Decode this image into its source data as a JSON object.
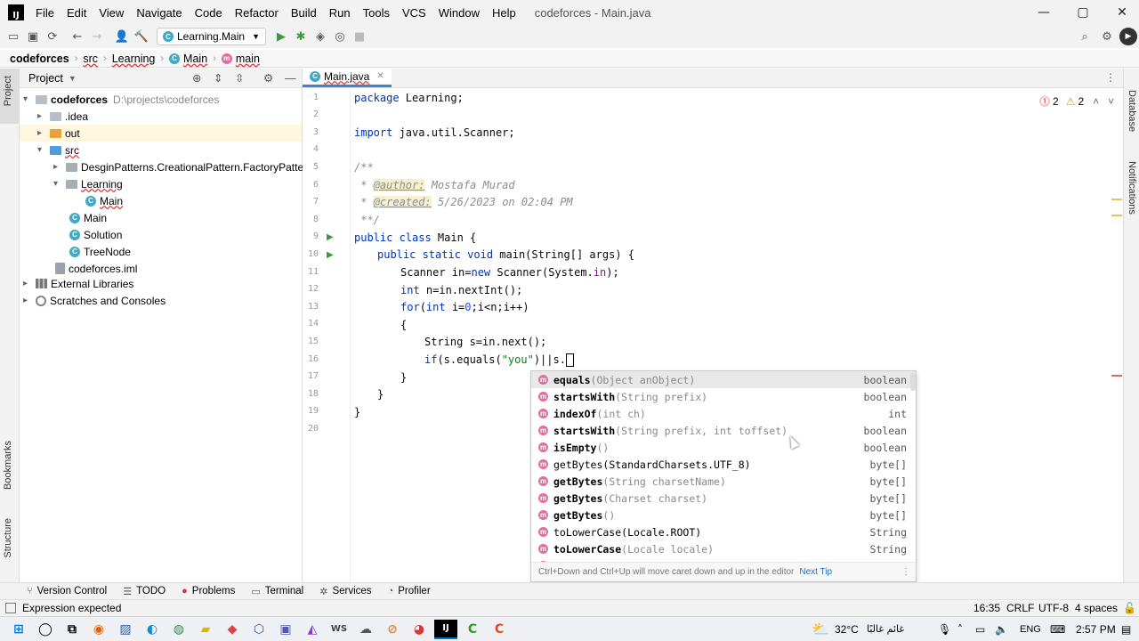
{
  "menubar": {
    "logo": "IJ",
    "items": [
      "File",
      "Edit",
      "View",
      "Navigate",
      "Code",
      "Refactor",
      "Build",
      "Run",
      "Tools",
      "VCS",
      "Window",
      "Help"
    ],
    "title": "codeforces - Main.java"
  },
  "toolbar": {
    "run_config": "Learning.Main"
  },
  "breadcrumbs": [
    "codeforces",
    "src",
    "Learning",
    "Main",
    "main"
  ],
  "project_panel": {
    "title": "Project",
    "tree": [
      {
        "label": "codeforces",
        "extra": "D:\\projects\\codeforces"
      },
      {
        "label": ".idea"
      },
      {
        "label": "out"
      },
      {
        "label": "src"
      },
      {
        "label": "DesginPatterns.CreationalPattern.FactoryPattern"
      },
      {
        "label": "Learning"
      },
      {
        "label": "Main"
      },
      {
        "label": "Main"
      },
      {
        "label": "Solution"
      },
      {
        "label": "TreeNode"
      },
      {
        "label": "codeforces.iml"
      },
      {
        "label": "External Libraries"
      },
      {
        "label": "Scratches and Consoles"
      }
    ]
  },
  "side_labels": {
    "project": "Project",
    "bookmarks": "Bookmarks",
    "structure": "Structure",
    "database": "Database",
    "notifications": "Notifications"
  },
  "editor": {
    "tab": "Main.java",
    "errors": "2",
    "warnings": "2",
    "line_numbers": [
      "1",
      "2",
      "3",
      "4",
      "5",
      "6",
      "7",
      "8",
      "9",
      "10",
      "11",
      "12",
      "13",
      "14",
      "15",
      "16",
      "17",
      "18",
      "19",
      "20"
    ],
    "code": {
      "l1_kw": "package",
      "l1_rest": " Learning;",
      "l3_kw": "import",
      "l3_rest": " java.util.Scanner;",
      "l5": "/**",
      "l6_pre": " * ",
      "l6_tag": "@author:",
      "l6_rest": " Mostafa Murad",
      "l7_pre": " * ",
      "l7_tag": "@created:",
      "l7_rest": " 5/26/2023 on 02:04 PM",
      "l8": " **/",
      "l9_kw": "public class",
      "l9_rest": " Main {",
      "l10_kw": "public static void",
      "l10_rest": " main(String[] args) {",
      "l11_a": "Scanner in=",
      "l11_kw": "new",
      "l11_b": " Scanner(System.",
      "l11_f": "in",
      "l11_c": ");",
      "l12_kw": "int",
      "l12_rest": " n=in.nextInt();",
      "l13_kw": "for",
      "l13_a": "(",
      "l13_kw2": "int",
      "l13_b": " i=",
      "l13_n": "0",
      "l13_c": ";i<n;i++)",
      "l14": "{",
      "l15": "String s=in.next();",
      "l16_kw": "if",
      "l16_a": "(s.equals(",
      "l16_s": "\"you\"",
      "l16_b": ")||s.",
      "l17": "}",
      "l18": "}",
      "l19": "}"
    }
  },
  "completion": {
    "items": [
      {
        "name": "equals",
        "params": "(Object anObject)",
        "type": "boolean"
      },
      {
        "name": "startsWith",
        "params": "(String prefix)",
        "type": "boolean"
      },
      {
        "name": "indexOf",
        "params": "(int ch)",
        "type": "int"
      },
      {
        "name": "startsWith",
        "params": "(String prefix, int toffset)",
        "type": "boolean"
      },
      {
        "name": "isEmpty",
        "params": "()",
        "type": "boolean"
      },
      {
        "name": "getBytes",
        "params": "(StandardCharsets.UTF_8)",
        "type": "byte[]"
      },
      {
        "name": "getBytes",
        "params": "(String charsetName)",
        "type": "byte[]"
      },
      {
        "name": "getBytes",
        "params": "(Charset charset)",
        "type": "byte[]"
      },
      {
        "name": "getBytes",
        "params": "()",
        "type": "byte[]"
      },
      {
        "name": "toLowerCase",
        "params": "(Locale.ROOT)",
        "type": "String"
      },
      {
        "name": "toLowerCase",
        "params": "(Locale locale)",
        "type": "String"
      },
      {
        "name": "toLowerCase",
        "params": "()",
        "type": "String"
      }
    ],
    "footer": "Ctrl+Down and Ctrl+Up will move caret down and up in the editor",
    "next_tip": "Next Tip"
  },
  "bottom_tabs": [
    "Version Control",
    "TODO",
    "Problems",
    "Terminal",
    "Services",
    "Profiler"
  ],
  "status": {
    "message": "Expression expected",
    "position": "16:35",
    "line_sep": "CRLF",
    "encoding": "UTF-8",
    "indent": "4 spaces"
  },
  "taskbar": {
    "temperature": "32°C",
    "weather": "غائم غالبًا",
    "lang": "ENG",
    "time": "2:57 PM"
  },
  "colors": {
    "accent": "#4083c9",
    "keyword": "#0033b3",
    "string": "#067d17",
    "method_badge": "#e26d9e",
    "class_badge": "#3fa9c7"
  }
}
